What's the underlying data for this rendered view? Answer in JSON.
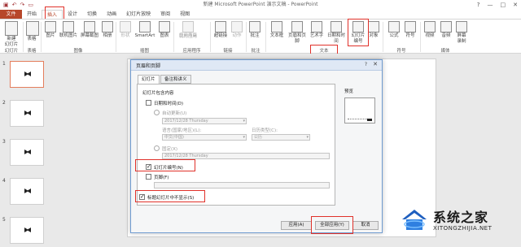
{
  "window": {
    "title": "新建 Microsoft PowerPoint 演示文稿 - PowerPoint",
    "qat_icons": [
      "save-icon",
      "undo-icon",
      "redo-icon",
      "start-from-beginning-icon"
    ],
    "controls": [
      "?",
      "—",
      "□",
      "✕"
    ]
  },
  "tabs": [
    {
      "label": "文件"
    },
    {
      "label": "开始"
    },
    {
      "label": "插入"
    },
    {
      "label": "设计"
    },
    {
      "label": "切换"
    },
    {
      "label": "动画"
    },
    {
      "label": "幻灯片放映"
    },
    {
      "label": "审阅"
    },
    {
      "label": "视图"
    }
  ],
  "ribbon": {
    "buttons": [
      {
        "label": "新建\n幻灯片",
        "icon": "new-slide-icon"
      },
      {
        "label": "表格",
        "icon": "table-icon"
      },
      {
        "label": "图片",
        "icon": "picture-icon"
      },
      {
        "label": "联机图片",
        "icon": "online-pictures-icon"
      },
      {
        "label": "屏幕截图",
        "icon": "screenshot-icon"
      },
      {
        "label": "相册",
        "icon": "photo-album-icon"
      },
      {
        "label": "形状",
        "icon": "shapes-icon"
      },
      {
        "label": "SmartArt",
        "icon": "smartart-icon"
      },
      {
        "label": "图表",
        "icon": "chart-icon"
      },
      {
        "label": "应用商店",
        "icon": "store-icon"
      },
      {
        "label": "我的应用",
        "icon": "my-apps-icon"
      },
      {
        "label": "超链接",
        "icon": "hyperlink-icon"
      },
      {
        "label": "动作",
        "icon": "action-icon"
      },
      {
        "label": "批注",
        "icon": "comment-icon"
      },
      {
        "label": "文本框",
        "icon": "text-box-icon"
      },
      {
        "label": "页眉和页脚",
        "icon": "header-footer-icon"
      },
      {
        "label": "艺术字",
        "icon": "wordart-icon"
      },
      {
        "label": "日期和时间",
        "icon": "date-time-icon"
      },
      {
        "label": "幻灯片\n编号",
        "icon": "slide-number-icon"
      },
      {
        "label": "对象",
        "icon": "object-icon"
      },
      {
        "label": "公式",
        "icon": "equation-icon"
      },
      {
        "label": "符号",
        "icon": "symbol-icon"
      },
      {
        "label": "视频",
        "icon": "video-icon"
      },
      {
        "label": "音频",
        "icon": "audio-icon"
      },
      {
        "label": "屏幕\n录制",
        "icon": "screen-recording-icon"
      }
    ],
    "groups": [
      "幻灯片",
      "表格",
      "图像",
      "插图",
      "应用程序",
      "链接",
      "批注",
      "文本",
      "符号",
      "媒体"
    ]
  },
  "slides": [
    {
      "number": "1"
    },
    {
      "number": "2"
    },
    {
      "number": "3"
    },
    {
      "number": "4"
    },
    {
      "number": "5"
    }
  ],
  "dialog": {
    "title": "页眉和页脚",
    "help": "?",
    "close": "✕",
    "tabs": [
      {
        "label": "幻灯片"
      },
      {
        "label": "备注和讲义"
      }
    ],
    "section_title": "幻灯片包含内容",
    "date_time": {
      "label": "日期和时间(D)",
      "checked": false
    },
    "auto_update": {
      "label": "自动更新(U)",
      "value": "2017/12/28 Thursday"
    },
    "language": {
      "label": "语言(国家/地区)(L):",
      "value": "中文(中国)"
    },
    "calendar": {
      "label": "日历类型(C):",
      "value": "公历"
    },
    "fixed": {
      "label": "固定(X)",
      "value": "2017/12/28 Thursday"
    },
    "slide_number": {
      "label": "幻灯片编号(N)",
      "checked": true
    },
    "footer": {
      "label": "页脚(F)",
      "checked": false
    },
    "hide_title": {
      "label": "标题幻灯片中不显示(S)",
      "checked": true
    },
    "preview_label": "预览",
    "buttons": {
      "apply": "应用(A)",
      "apply_all": "全部应用(Y)",
      "cancel": "取消"
    }
  },
  "watermark": {
    "brand": "系统之家",
    "url": "XITONGZHIJIA.NET"
  },
  "colors": {
    "accent": "#b7472a",
    "highlight": "#e0312a",
    "dialog_border": "#6f9bd0"
  }
}
